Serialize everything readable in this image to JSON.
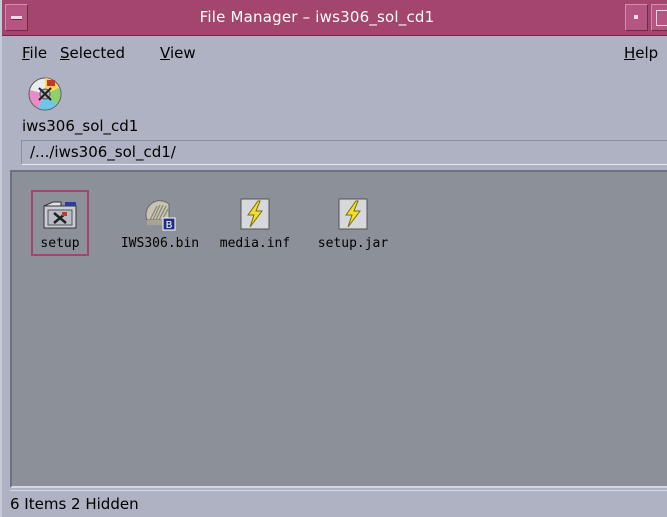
{
  "window": {
    "title": "File Manager – iws306_sol_cd1",
    "accent": "#a4456e"
  },
  "menu": {
    "file": "File",
    "selected": "Selected",
    "view": "View",
    "help": "Help"
  },
  "current": {
    "name": "iws306_sol_cd1",
    "icon": "cdrom-icon"
  },
  "path": "/.../iws306_sol_cd1/",
  "files": [
    {
      "name": "setup",
      "icon": "folder-icon",
      "selected": true
    },
    {
      "name": "IWS306.bin",
      "icon": "binary-file-icon",
      "selected": false
    },
    {
      "name": "media.inf",
      "icon": "data-file-icon",
      "selected": false
    },
    {
      "name": "setup.jar",
      "icon": "data-file-icon",
      "selected": false
    }
  ],
  "status": "6 Items 2 Hidden"
}
